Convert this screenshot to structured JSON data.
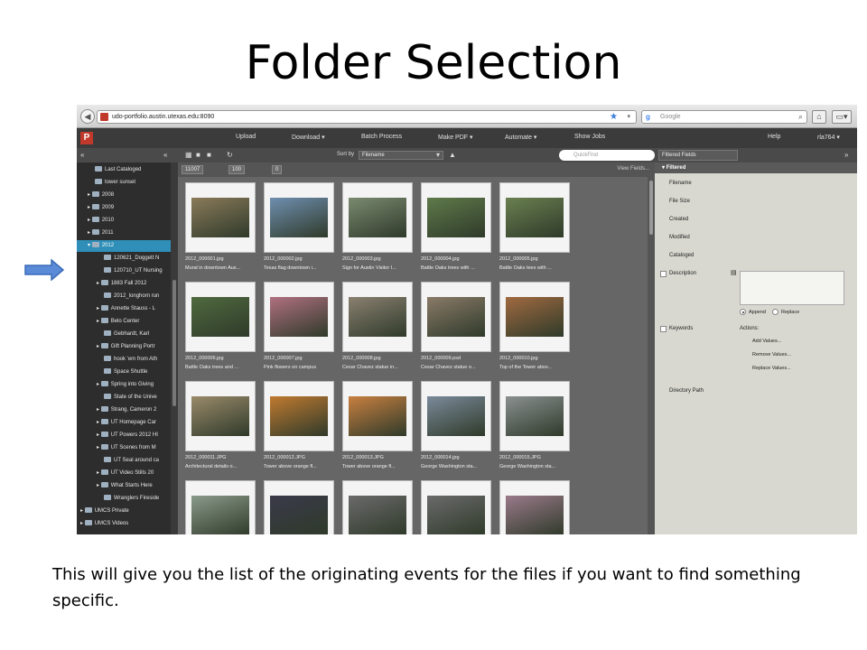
{
  "slide": {
    "title": "Folder Selection",
    "caption": "This will give you the list of the originating events for the files if you want to find something specific."
  },
  "browser": {
    "url": "udo-portfolio.austin.utexas.edu:8090",
    "search_engine": "Google"
  },
  "app": {
    "logo": "P",
    "menu": [
      "Upload",
      "Download ▾",
      "Batch Process",
      "Make PDF ▾",
      "Automate ▾",
      "Show Jobs",
      "Help",
      "rla764 ▾"
    ]
  },
  "toolbar": {
    "sort_label": "Sort by",
    "sort_value": "Filename",
    "quickfind_placeholder": "QuickFind",
    "filtered_fields": "Filtered Fields"
  },
  "grid_bar": {
    "counts": [
      "11007",
      "100",
      "0"
    ],
    "view_fields": "View Fields..."
  },
  "sidebar": {
    "items": [
      {
        "label": "Last Cataloged"
      },
      {
        "label": "tower sunset"
      },
      {
        "label": "2008"
      },
      {
        "label": "2009"
      },
      {
        "label": "2010"
      },
      {
        "label": "2011"
      },
      {
        "label": "2012"
      },
      {
        "label": "120621_Doggett N"
      },
      {
        "label": "120710_UT Nursing"
      },
      {
        "label": "1883 Fall 2012"
      },
      {
        "label": "2012_longhorn run"
      },
      {
        "label": "Annette Stauss - L"
      },
      {
        "label": "Belo Center"
      },
      {
        "label": "Gebhardt, Karl"
      },
      {
        "label": "Gift Planning Portr"
      },
      {
        "label": "hook 'em from Ath"
      },
      {
        "label": "Space Shuttle"
      },
      {
        "label": "Spring into Giving"
      },
      {
        "label": "State of the Unive"
      },
      {
        "label": "Strang, Cameron 2"
      },
      {
        "label": "UT Homepage Car"
      },
      {
        "label": "UT Powers 2012 HI"
      },
      {
        "label": "UT Scenes from M"
      },
      {
        "label": "UT Seal around ca"
      },
      {
        "label": "UT Video Stills 20"
      },
      {
        "label": "What Starts Here"
      },
      {
        "label": "Wranglers Fireside"
      },
      {
        "label": "UMCS Private"
      },
      {
        "label": "UMCS Videos"
      }
    ]
  },
  "thumbnails": [
    {
      "name": "2012_000001.jpg",
      "desc": "Mural in downtown Aus...",
      "color": "#8a7a5a"
    },
    {
      "name": "2012_000002.jpg",
      "desc": "Texas flag downtown i...",
      "color": "#6f8fb0"
    },
    {
      "name": "2012_000003.jpg",
      "desc": "Sign for Austin Visitor I...",
      "color": "#7a8a70"
    },
    {
      "name": "2012_000004.jpg",
      "desc": "Battle Oaks trees with ...",
      "color": "#5f7a4a"
    },
    {
      "name": "2012_000005.jpg",
      "desc": "Battle Oaks tees with ...",
      "color": "#6a8050"
    },
    {
      "name": "2012_000006.jpg",
      "desc": "Battle Oaks trees and ...",
      "color": "#4f6a3f"
    },
    {
      "name": "2012_000007.jpg",
      "desc": "Pink flowers on campus",
      "color": "#b07080"
    },
    {
      "name": "2012_000008.jpg",
      "desc": "Cesar Chavez statue in...",
      "color": "#8a8070"
    },
    {
      "name": "2012_000009.psd",
      "desc": "Cesar Chavez statue o...",
      "color": "#8a7a68"
    },
    {
      "name": "2012_000010.jpg",
      "desc": "Top of the Tower abov...",
      "color": "#a06a40"
    },
    {
      "name": "2012_000011.JPG",
      "desc": "Architectural details o...",
      "color": "#9a8a6a"
    },
    {
      "name": "2012_000012.JPG",
      "desc": "Tower above orange fl...",
      "color": "#c07a30"
    },
    {
      "name": "2012_000013.JPG",
      "desc": "Tower above orange fl...",
      "color": "#c88040"
    },
    {
      "name": "2012_000014.jpg",
      "desc": "George Washington sta...",
      "color": "#7a8a9a"
    },
    {
      "name": "2012_000015.JPG",
      "desc": "George Washington sta...",
      "color": "#8a9090"
    },
    {
      "name": "",
      "desc": "",
      "color": "#8a9a8a"
    },
    {
      "name": "",
      "desc": "",
      "color": "#3a3a4a"
    },
    {
      "name": "",
      "desc": "",
      "color": "#6a6a6a"
    },
    {
      "name": "",
      "desc": "",
      "color": "#6a6a6a"
    },
    {
      "name": "",
      "desc": "",
      "color": "#9a7a8a"
    }
  ],
  "right_panel": {
    "header": "Filtered",
    "fields": [
      "Filename",
      "File Size",
      "Created",
      "Modified",
      "Cataloged"
    ],
    "description_label": "Description",
    "append_label": "Append",
    "replace_label": "Replace",
    "keywords_label": "Keywords",
    "actions_label": "Actions:",
    "actions": [
      "Add Values...",
      "Remove Values...",
      "Replace Values..."
    ],
    "directory_path": "Directory Path"
  },
  "colors": {
    "selected_folder": "#2f8fb8",
    "arrow": "#5b8ad6"
  }
}
